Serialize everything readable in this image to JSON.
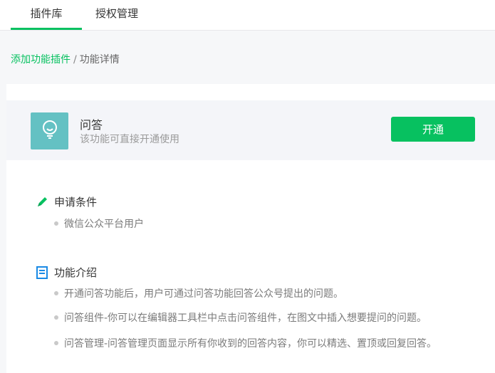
{
  "tabs": [
    {
      "label": "插件库"
    },
    {
      "label": "授权管理"
    }
  ],
  "breadcrumb": {
    "parent": "添加功能插件",
    "separator": "/",
    "current": "功能详情"
  },
  "plugin": {
    "icon": "lightbulb-icon",
    "title": "问答",
    "description": "该功能可直接开通使用",
    "open_button": "开通"
  },
  "requirements": {
    "heading": "申请条件",
    "icon": "pencil-icon",
    "items": [
      "微信公众平台用户"
    ]
  },
  "intro": {
    "heading": "功能介绍",
    "icon": "document-icon",
    "items": [
      "开通问答功能后，用户可通过问答功能回答公众号提出的问题。",
      "问答组件-你可以在编辑器工具栏中点击问答组件，在图文中插入想要提问的问题。",
      "问答管理-问答管理页面显示所有你收到的回答内容，你可以精选、置顶或回复回答。"
    ]
  },
  "colors": {
    "accent": "#07c160",
    "icon_bg": "#64c1c3"
  }
}
